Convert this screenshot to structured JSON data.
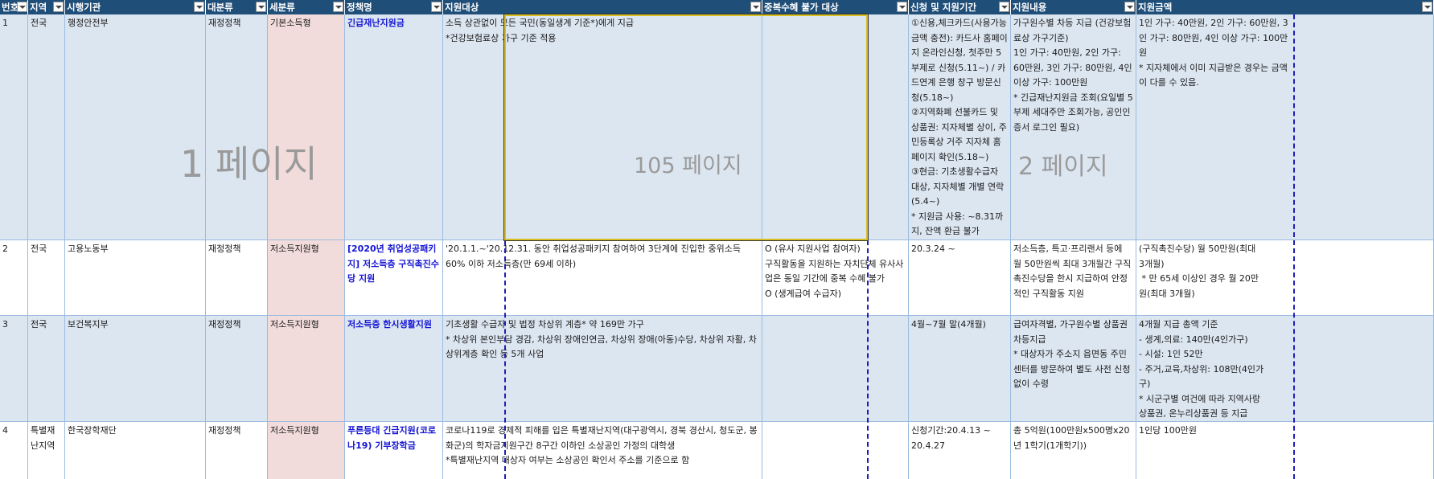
{
  "headers": {
    "no": "번호",
    "region": "지역",
    "agency": "시행기관",
    "major_category": "대분류",
    "minor_category": "세분류",
    "policy_name": "정책명",
    "target": "지원대상",
    "duplicate_restriction": "중복수혜 불가 대상",
    "application_period": "신청 및 지원기간",
    "support_content": "지원내용",
    "support_amount": "지원금액"
  },
  "watermarks": {
    "page1": "1 페이지",
    "page105": "105 페이지",
    "page2xx": "2  페이지"
  },
  "rows": [
    {
      "no": "1",
      "region": "전국",
      "agency": "행정안전부",
      "major_category": "재정정책",
      "minor_category": "기본소득형",
      "policy_name": "긴급재난지원금",
      "target": "소득 상관없이 모든 국민(동일생계 기준*)에게 지급\n*건강보험료상 가구 기준 적용",
      "duplicate_restriction": "",
      "application_period": "①신용,체크카드(사용가능금액 충전): 카드사 홈페이지 온라인신청, 첫주만 5부제로 신청(5.11~) / 카드연계 은행 창구 방문신청(5.18~)\n②지역화폐 선불카드 및 상품권: 지자체별 상이, 주민등록상 거주 지자체 홈페이지 확인(5.18~)\n③현금: 기초생활수급자 대상, 지자체별 개별 연락(5.4~)\n* 지원금 사용: ~8.31까지, 잔액 환급 불가",
      "support_content": "가구원수별 차등 지급 (건강보험료상 가구기준)\n1인 가구: 40만원, 2인 가구: 60만원, 3인 가구: 80만원, 4인 이상 가구: 100만원\n* 긴급재난지원금 조회(요일별 5부제 세대주만 조회가능, 공인인증서 로그인 필요)",
      "support_amount": "1인 가구: 40만원, 2인 가구: 60만원, 3인 가구: 80만원, 4인 이상 가구: 100만원\n* 지자체에서 이미 지급받은 경우는 금액이 다를 수 있음."
    },
    {
      "no": "2",
      "region": "전국",
      "agency": "고용노동부",
      "major_category": "재정정책",
      "minor_category": "저소득지원형",
      "policy_name": "[2020년 취업성공패키지] 저소득층 구직촉진수당 지원",
      "target": "'20.1.1.~'20.12.31. 동안 취업성공패키지 참여하여 3단계에 진입한 중위소득 60% 이하 저소득층(만 69세 이하)",
      "duplicate_restriction": "O (유사 지원사업 참여자)\n구직활동을 지원하는 자치단체 유사사업은 동일 기간에 중복 수혜 불가\nO (생계급여 수급자)",
      "application_period": "20.3.24 ~",
      "support_content": "저소득층, 특고·프리랜서 등에 월 50만원씩 최대 3개월간 구직촉진수당을 한시 지급하여 안정적인 구직활동 지원",
      "support_amount": "(구직촉진수당) 월 50만원(최대 3개월)\n * 만 65세 이상인 경우 월 20만원(최대 3개월)"
    },
    {
      "no": "3",
      "region": "전국",
      "agency": "보건복지부",
      "major_category": "재정정책",
      "minor_category": "저소득지원형",
      "policy_name": "저소득층 한시생활지원",
      "target": "기초생활 수급자 및 법정 차상위 계층* 약 169만 가구\n* 차상위 본인부담 경감, 차상위 장애인연금, 차상위 장애(아동)수당, 차상위 자활, 차상위계층 확인 등 5개 사업",
      "duplicate_restriction": "",
      "application_period": "4월~7월 말(4개월)",
      "support_content": "급여자격별, 가구원수별 상품권 차등지급\n* 대상자가 주소지 읍면동 주민센터를 방문하여 별도 사전 신청 없이 수령",
      "support_amount": "4개월 지급 총액 기준\n- 생계,의료: 140만(4인가구)\n- 시설: 1인 52만\n- 주거,교육,차상위: 108만(4인가구)\n* 시군구별 여건에 따라 지역사랑상품권, 온누리상품권 등 지급"
    },
    {
      "no": "4",
      "region": "특별재난지역",
      "agency": "한국장학재단",
      "major_category": "재정정책",
      "minor_category": "저소득지원형",
      "policy_name": "푸른등대 긴급지원(코로나19) 기부장학금",
      "target": "코로나119로 경제적 피해를 입은 특별재난지역(대구광역시, 경북 경산시, 청도군, 봉화군)의 학자금지원구간 8구간 이하인 소상공인 가정의 대학생\n*특별재난지역 대상자 여부는 소상공인 확인서 주소를 기준으로 함",
      "duplicate_restriction": "",
      "application_period": "신청기간:20.4.13 ~ 20.4.27",
      "support_content": "총 5억원(100만원x500명x20년 1학기(1개학기))",
      "support_amount": "1인당 100만원"
    }
  ]
}
